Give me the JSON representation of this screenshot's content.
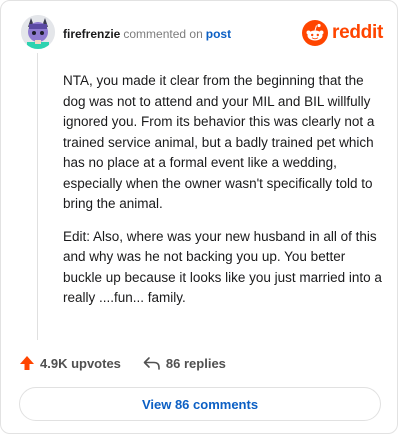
{
  "header": {
    "username": "firefrenzie",
    "action_text": "commented on",
    "post_link": "post",
    "brand": "reddit"
  },
  "comment": {
    "paragraphs": [
      "NTA, you made it clear from the beginning that the dog was not to attend and your MIL and BIL willfully ignored you. From its behavior this was clearly not a trained service animal, but a badly trained pet which has no place at a formal event like a wedding, especially when the owner wasn't specifically told to bring the animal.",
      "Edit: Also, where was your new husband in all of this and why was he not backing you up. You better buckle up because it looks like you just married into a really ....fun... family."
    ]
  },
  "actions": {
    "upvotes": "4.9K upvotes",
    "replies": "86 replies"
  },
  "footer": {
    "view_button": "View 86 comments"
  },
  "colors": {
    "brand": "#ff4500",
    "link": "#0b5fc4"
  },
  "icons": [
    "avatar",
    "reddit-logo-icon",
    "upvote-arrow-icon",
    "reply-arrow-icon"
  ]
}
